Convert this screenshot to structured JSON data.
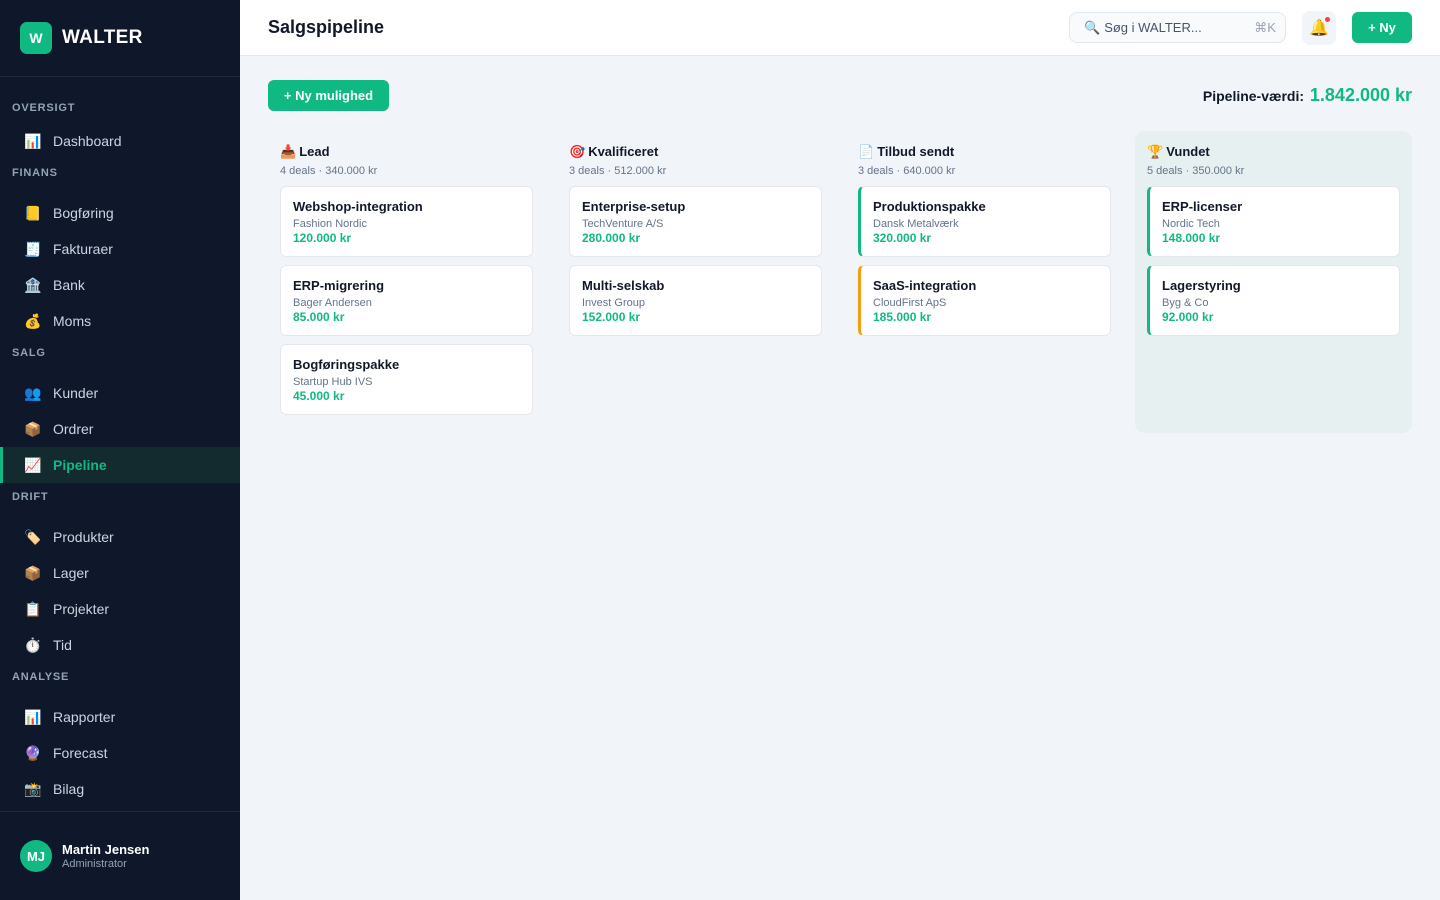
{
  "brand": {
    "logo_letter": "W",
    "name": "WALTER"
  },
  "sidebar": {
    "sections": [
      {
        "label": "OVERSIGT",
        "items": [
          {
            "icon": "📊",
            "icon_name": "dashboard-chart-icon",
            "label": "Dashboard"
          }
        ]
      },
      {
        "label": "FINANS",
        "items": [
          {
            "icon": "📒",
            "icon_name": "ledger-icon",
            "label": "Bogføring"
          },
          {
            "icon": "🧾",
            "icon_name": "receipt-icon",
            "label": "Fakturaer"
          },
          {
            "icon": "🏦",
            "icon_name": "bank-icon",
            "label": "Bank"
          },
          {
            "icon": "💰",
            "icon_name": "money-bag-icon",
            "label": "Moms"
          }
        ]
      },
      {
        "label": "SALG",
        "items": [
          {
            "icon": "👥",
            "icon_name": "customers-icon",
            "label": "Kunder"
          },
          {
            "icon": "📦",
            "icon_name": "package-icon",
            "label": "Ordrer"
          },
          {
            "icon": "📈",
            "icon_name": "trend-chart-icon",
            "label": "Pipeline",
            "active": true
          }
        ]
      },
      {
        "label": "DRIFT",
        "items": [
          {
            "icon": "🏷️",
            "icon_name": "tag-icon",
            "label": "Produkter"
          },
          {
            "icon": "📦",
            "icon_name": "package-icon",
            "label": "Lager"
          },
          {
            "icon": "📋",
            "icon_name": "clipboard-icon",
            "label": "Projekter"
          },
          {
            "icon": "⏱️",
            "icon_name": "stopwatch-icon",
            "label": "Tid"
          }
        ]
      },
      {
        "label": "ANALYSE",
        "items": [
          {
            "icon": "📊",
            "icon_name": "report-chart-icon",
            "label": "Rapporter"
          },
          {
            "icon": "🔮",
            "icon_name": "crystal-ball-icon",
            "label": "Forecast"
          },
          {
            "icon": "📸",
            "icon_name": "camera-icon",
            "label": "Bilag"
          }
        ]
      }
    ]
  },
  "user": {
    "initials": "MJ",
    "name": "Martin Jensen",
    "role": "Administrator"
  },
  "header": {
    "title": "Salgspipeline",
    "search_placeholder": "Søg i WALTER...",
    "search_icon": "🔍",
    "search_shortcut": "⌘K",
    "bell_icon": "🔔",
    "new_label": "+ Ny"
  },
  "main": {
    "add_opportunity_label": "+ Ny mulighed",
    "pipeline_value_label": "Pipeline-værdi:",
    "pipeline_value_amount": "1.842.000 kr"
  },
  "columns": [
    {
      "icon": "📥",
      "title": "Lead",
      "meta": "4 deals · 340.000 kr",
      "cards": [
        {
          "title": "Webshop-integration",
          "company": "Fashion Nordic",
          "amount": "120.000 kr"
        },
        {
          "title": "ERP-migrering",
          "company": "Bager Andersen",
          "amount": "85.000 kr"
        },
        {
          "title": "Bogføringspakke",
          "company": "Startup Hub IVS",
          "amount": "45.000 kr"
        }
      ]
    },
    {
      "icon": "🎯",
      "title": "Kvalificeret",
      "meta": "3 deals · 512.000 kr",
      "cards": [
        {
          "title": "Enterprise-setup",
          "company": "TechVenture A/S",
          "amount": "280.000 kr"
        },
        {
          "title": "Multi-selskab",
          "company": "Invest Group",
          "amount": "152.000 kr"
        }
      ]
    },
    {
      "icon": "📄",
      "title": "Tilbud sendt",
      "meta": "3 deals · 640.000 kr",
      "cards": [
        {
          "title": "Produktionspakke",
          "company": "Dansk Metalværk",
          "amount": "320.000 kr",
          "accent": "green"
        },
        {
          "title": "SaaS-integration",
          "company": "CloudFirst ApS",
          "amount": "185.000 kr",
          "accent": "amber"
        }
      ]
    },
    {
      "icon": "🏆",
      "title": "Vundet",
      "meta": "5 deals · 350.000 kr",
      "won": true,
      "cards": [
        {
          "title": "ERP-licenser",
          "company": "Nordic Tech",
          "amount": "148.000 kr",
          "accent": "green"
        },
        {
          "title": "Lagerstyring",
          "company": "Byg & Co",
          "amount": "92.000 kr",
          "accent": "green"
        }
      ]
    }
  ],
  "colors": {
    "accent": "#10b981",
    "sidebar_bg": "#0f172a",
    "amber": "#f59e0b",
    "background": "#f1f4f8"
  }
}
